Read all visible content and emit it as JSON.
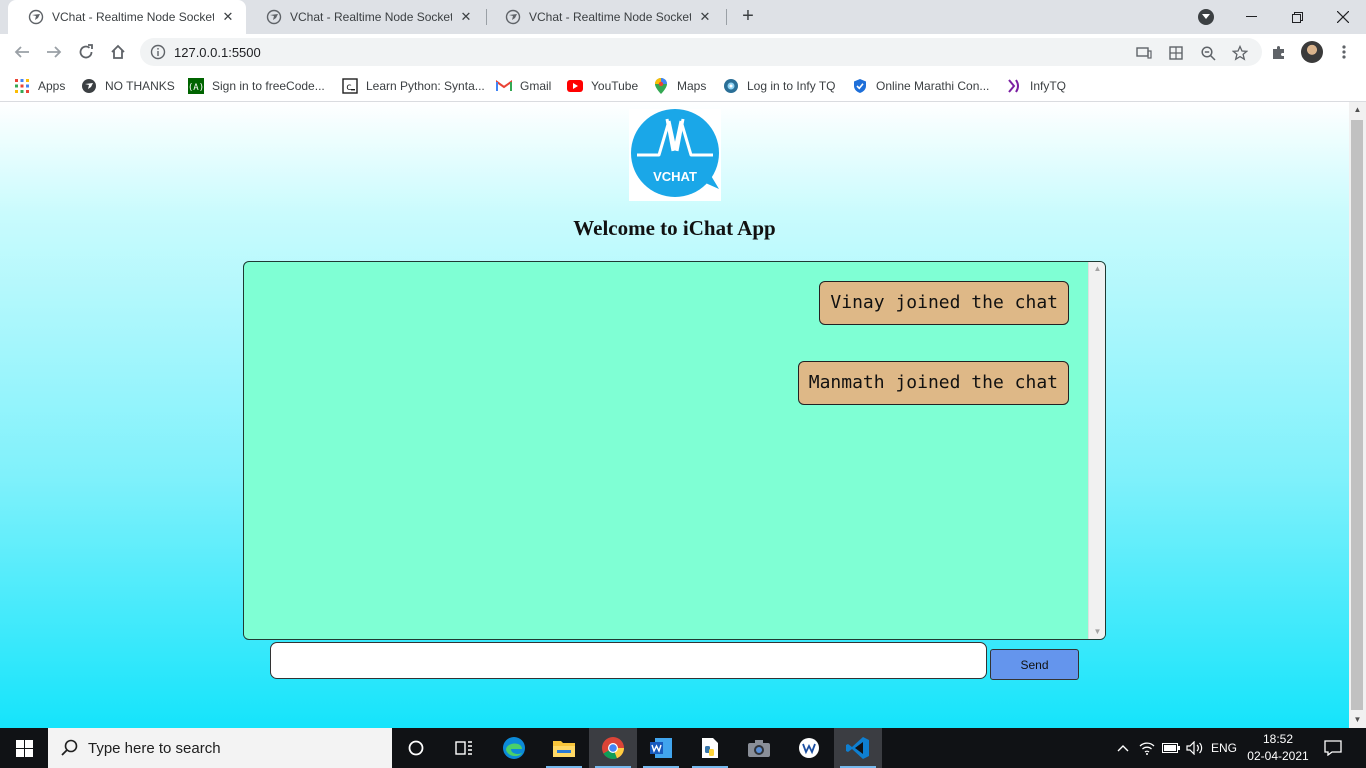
{
  "browser": {
    "tabs": [
      {
        "title": "VChat - Realtime Node Socket.io",
        "active": true
      },
      {
        "title": "VChat - Realtime Node Socket.io",
        "active": false
      },
      {
        "title": "VChat - Realtime Node Socket.io",
        "active": false
      }
    ],
    "url": "127.0.0.1:5500",
    "bookmarks": [
      {
        "label": "Apps",
        "icon": "apps-grid-icon"
      },
      {
        "label": "NO THANKS",
        "icon": "globe-icon"
      },
      {
        "label": "Sign in to freeCode...",
        "icon": "freecodecamp-icon"
      },
      {
        "label": "Learn Python: Synta...",
        "icon": "codecademy-icon"
      },
      {
        "label": "Gmail",
        "icon": "gmail-icon"
      },
      {
        "label": "YouTube",
        "icon": "youtube-icon"
      },
      {
        "label": "Maps",
        "icon": "maps-icon"
      },
      {
        "label": "Log in to Infy TQ",
        "icon": "infytq-icon"
      },
      {
        "label": "Online Marathi Con...",
        "icon": "marathi-converter-icon"
      },
      {
        "label": "InfyTQ",
        "icon": "infytq-logo-icon"
      }
    ]
  },
  "page": {
    "logo_text": "VCHAT",
    "heading": "Welcome to iChat App",
    "messages": [
      {
        "text": "Vinay joined the chat"
      },
      {
        "text": "Manmath joined the chat"
      }
    ],
    "input_value": "",
    "input_placeholder": "",
    "send_label": "Send"
  },
  "taskbar": {
    "search_placeholder": "Type here to search",
    "language": "ENG",
    "time": "18:52",
    "date": "02-04-2021"
  },
  "colors": {
    "chat_background": "#7fffd4",
    "message_bubble": "#deb887",
    "send_button": "#6495ed",
    "logo_blue": "#1aa7e8"
  }
}
